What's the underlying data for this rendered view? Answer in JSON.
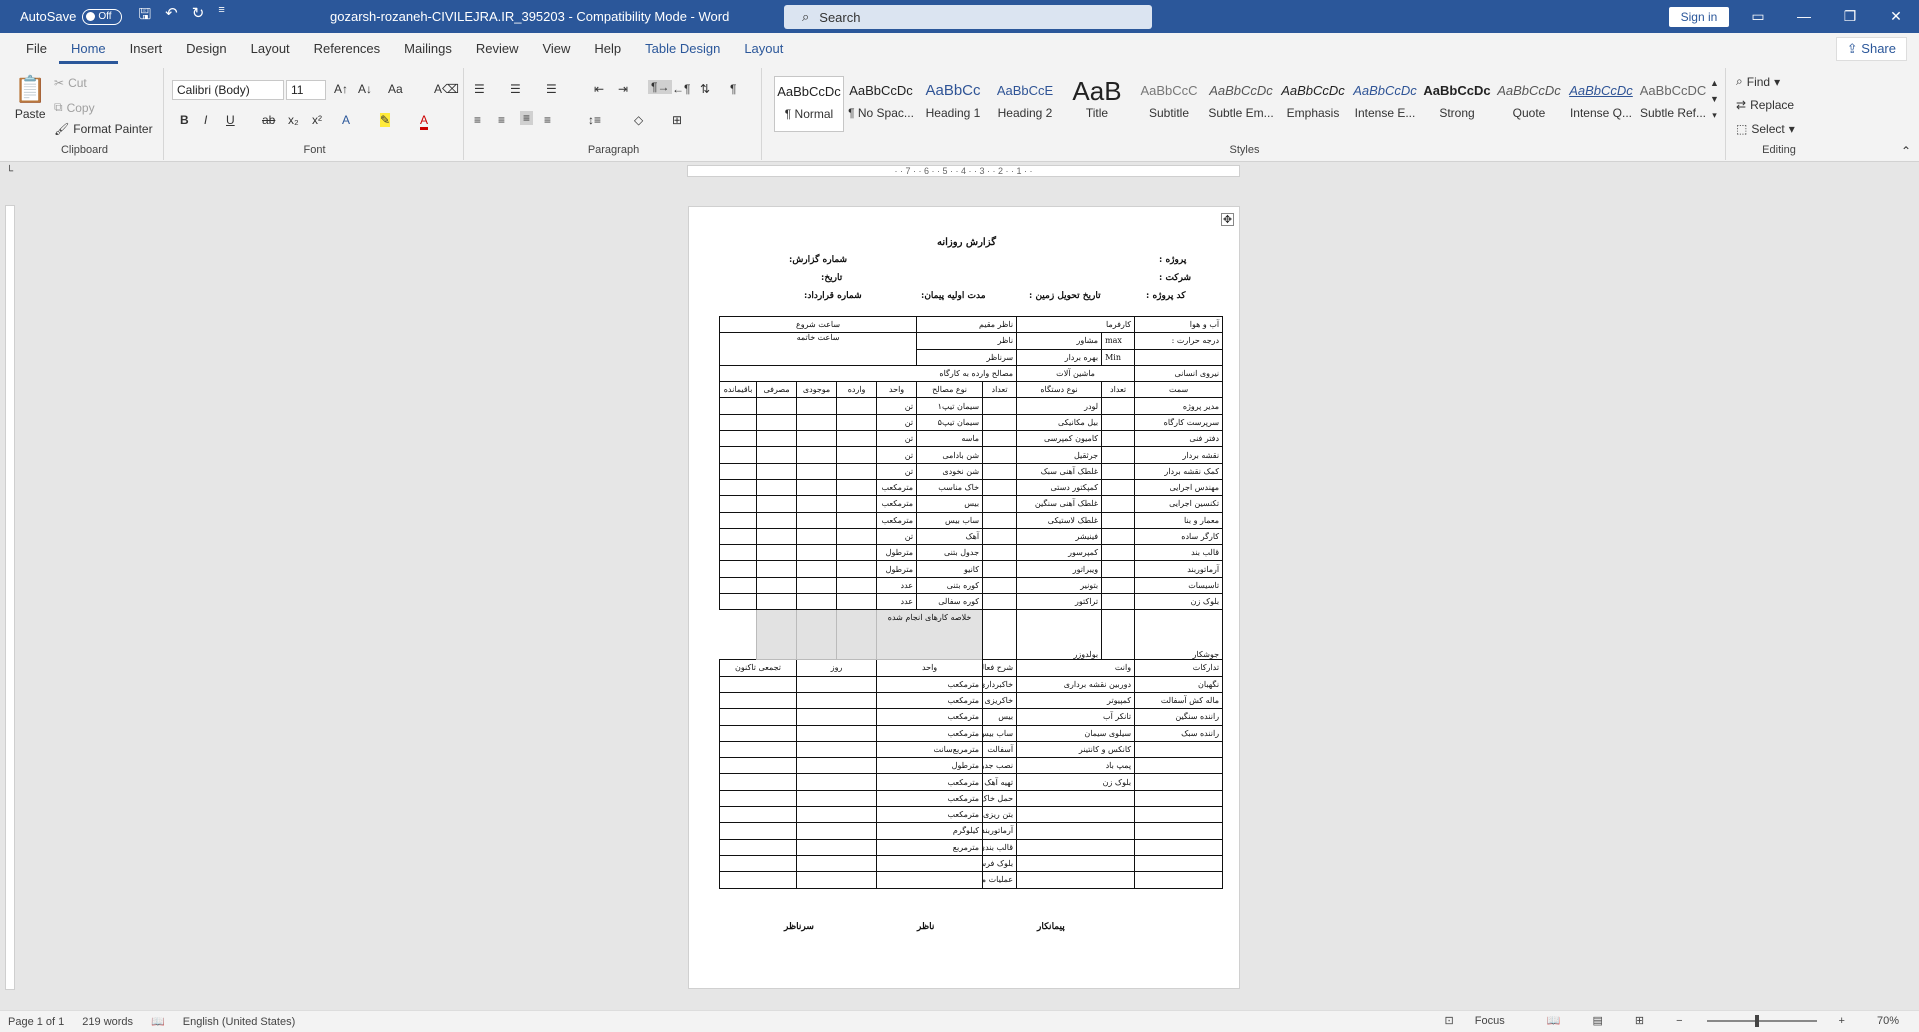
{
  "titlebar": {
    "autosave": "AutoSave",
    "toggle": "Off",
    "doc_title": "gozarsh-rozaneh-CIVILEJRA.IR_395203  -  Compatibility Mode  -  Word",
    "search": "Search",
    "signin": "Sign in"
  },
  "menu": {
    "tabs": [
      "File",
      "Home",
      "Insert",
      "Design",
      "Layout",
      "References",
      "Mailings",
      "Review",
      "View",
      "Help",
      "Table Design",
      "Layout"
    ],
    "share": "Share"
  },
  "ribbon": {
    "clipboard": {
      "paste": "Paste",
      "cut": "Cut",
      "copy": "Copy",
      "format_painter": "Format Painter",
      "label": "Clipboard"
    },
    "font": {
      "name": "Calibri (Body)",
      "size": "11",
      "label": "Font",
      "aa": "Aa"
    },
    "paragraph": {
      "label": "Paragraph"
    },
    "styles": {
      "label": "Styles",
      "items": [
        {
          "preview": "AaBbCcDc",
          "name": "¶ Normal"
        },
        {
          "preview": "AaBbCcDc",
          "name": "¶ No Spac..."
        },
        {
          "preview": "AaBbCc",
          "name": "Heading 1"
        },
        {
          "preview": "AaBbCcE",
          "name": "Heading 2"
        },
        {
          "preview": "AaB",
          "name": "Title"
        },
        {
          "preview": "AaBbCcC",
          "name": "Subtitle"
        },
        {
          "preview": "AaBbCcDc",
          "name": "Subtle Em..."
        },
        {
          "preview": "AaBbCcDc",
          "name": "Emphasis"
        },
        {
          "preview": "AaBbCcDc",
          "name": "Intense E..."
        },
        {
          "preview": "AaBbCcDc",
          "name": "Strong"
        },
        {
          "preview": "AaBbCcDc",
          "name": "Quote"
        },
        {
          "preview": "AaBbCcDc",
          "name": "Intense Q..."
        },
        {
          "preview": "AaBbCcDC",
          "name": "Subtle Ref..."
        }
      ]
    },
    "editing": {
      "find": "Find",
      "replace": "Replace",
      "select": "Select",
      "label": "Editing"
    }
  },
  "ruler": "· · 7 · · 6 · · 5 · · 4 · · 3 · · 2 · · 1 · ·",
  "document": {
    "title": "گزارش روزانه",
    "project": "پروژه :",
    "company": "شرکت :",
    "project_code": "کد پروژه :",
    "report_no": "شماره گزارش:",
    "date": "تاریخ:",
    "land_delivery": "تاریخ تحویل زمین :",
    "initial_duration": "مدت اولیه پیمان:",
    "contract_no": "شماره قرارداد:",
    "table_rows": [
      [
        "آب و هوا",
        "کارفرما",
        "",
        "ناظر مقیم",
        "",
        "ساعت شروع",
        "",
        ""
      ],
      [
        "درجه حرارت :",
        "مشاور",
        "max",
        "ناظر",
        "",
        "ساعت خاتمه",
        "",
        ""
      ],
      [
        "",
        "بهره بردار",
        "Min",
        "سرناظر",
        "",
        "",
        "",
        ""
      ],
      [
        "نیروی انسانی",
        "ماشین آلات",
        "",
        "مصالح وارده به کارگاه",
        "",
        "",
        "",
        ""
      ],
      [
        "سمت",
        "تعداد",
        "نوع دستگاه",
        "تعداد",
        "نوع مصالح",
        "واحد",
        "وارده",
        "موجودی",
        "مصرفی",
        "باقیمانده"
      ],
      [
        "مدیر پروژه",
        "",
        "لودر",
        "",
        "سیمان تیپ۱",
        "تن",
        "",
        "",
        "",
        ""
      ],
      [
        "سرپرست کارگاه",
        "",
        "بیل مکانیکی",
        "",
        "سیمان تیپ۵",
        "تن",
        "",
        "",
        "",
        ""
      ],
      [
        "دفتر فنی",
        "",
        "کامیون کمپرسی",
        "",
        "ماسه",
        "تن",
        "",
        "",
        "",
        ""
      ],
      [
        "نقشه بردار",
        "",
        "جرثقیل",
        "",
        "شن بادامی",
        "تن",
        "",
        "",
        "",
        ""
      ],
      [
        "کمک نقشه بردار",
        "",
        "غلطک آهنی سبک",
        "",
        "شن نخودی",
        "تن",
        "",
        "",
        "",
        ""
      ],
      [
        "مهندس اجرایی",
        "",
        "کمپکتور دستی",
        "",
        "خاک مناسب",
        "مترمکعب",
        "",
        "",
        "",
        ""
      ],
      [
        "تکنسین اجرایی",
        "",
        "غلطک آهنی سنگین",
        "",
        "بیس",
        "مترمکعب",
        "",
        "",
        "",
        ""
      ],
      [
        "معمار و بنا",
        "",
        "غلطک لاستیکی",
        "",
        "ساب بیس",
        "مترمکعب",
        "",
        "",
        "",
        ""
      ],
      [
        "کارگر ساده",
        "",
        "فینیشر",
        "",
        "آهک",
        "تن",
        "",
        "",
        "",
        ""
      ],
      [
        "قالب بند",
        "",
        "کمپرسور",
        "",
        "جدول بتنی",
        "مترطول",
        "",
        "",
        "",
        ""
      ],
      [
        "آرماتوربند",
        "",
        "ویبراتور",
        "",
        "کانیو",
        "مترطول",
        "",
        "",
        "",
        ""
      ],
      [
        "تاسیسات",
        "",
        "بتونیر",
        "",
        "کوره بتنی",
        "عدد",
        "",
        "",
        "",
        ""
      ],
      [
        "بلوک زن",
        "",
        "تراکتور",
        "",
        "کوره سفالی",
        "عدد",
        "",
        "",
        "",
        ""
      ]
    ],
    "summary_label": "خلاصه کارهای انجام شده",
    "row_welder": "جوشکار",
    "row_bulldozer": "بولدوزر",
    "activity_header": [
      "",
      "واحد",
      "شرح فعالیت",
      "واحد",
      "روز",
      "تجمعی تاکنون"
    ],
    "rows2": [
      [
        "تدارکات",
        "وانت",
        "شرح فعالیت",
        "واحد",
        "روز",
        "تجمعی تاکنون"
      ],
      [
        "نگهبان",
        "دوربین نقشه برداری",
        "خاکبرداری",
        "مترمکعب",
        "",
        ""
      ],
      [
        "ماله کش آسفالت",
        "کمپیوتر",
        "خاکریزی",
        "مترمکعب",
        "",
        ""
      ],
      [
        "راننده سنگین",
        "تانکر آب",
        "بیس",
        "مترمکعب",
        "",
        ""
      ],
      [
        "راننده سبک",
        "سیلوی سیمان",
        "ساب بیس",
        "مترمکعب",
        "",
        ""
      ],
      [
        "",
        "کانکس و کانتینر",
        "آسفالت",
        "مترمربع‌سانت",
        "",
        ""
      ],
      [
        "",
        "پمپ باد",
        "نصب جدول و کانیو",
        "مترطول",
        "",
        ""
      ],
      [
        "",
        "بلوک زن",
        "تهیه آهک",
        "مترمکعب",
        "",
        ""
      ],
      [
        "",
        "",
        "حمل خاک",
        "مترمکعب",
        "",
        ""
      ],
      [
        "",
        "",
        "بتن ریزی",
        "مترمکعب",
        "",
        ""
      ],
      [
        "",
        "",
        "آرماتوربندی",
        "کیلوگرم",
        "",
        ""
      ],
      [
        "",
        "",
        "قالب بندی",
        "مترمربع",
        "",
        ""
      ],
      [
        "",
        "",
        "بلوک فرش پیاده رو",
        "",
        "",
        ""
      ],
      [
        "",
        "",
        "عملیات متفرقه",
        "",
        "",
        ""
      ]
    ],
    "sign_contractor": "پیمانکار",
    "sign_supervisor": "ناظر",
    "sign_chief": "سرناظر"
  },
  "status": {
    "page": "Page 1 of 1",
    "words": "219 words",
    "lang": "English (United States)",
    "focus": "Focus",
    "zoom": "70%"
  }
}
